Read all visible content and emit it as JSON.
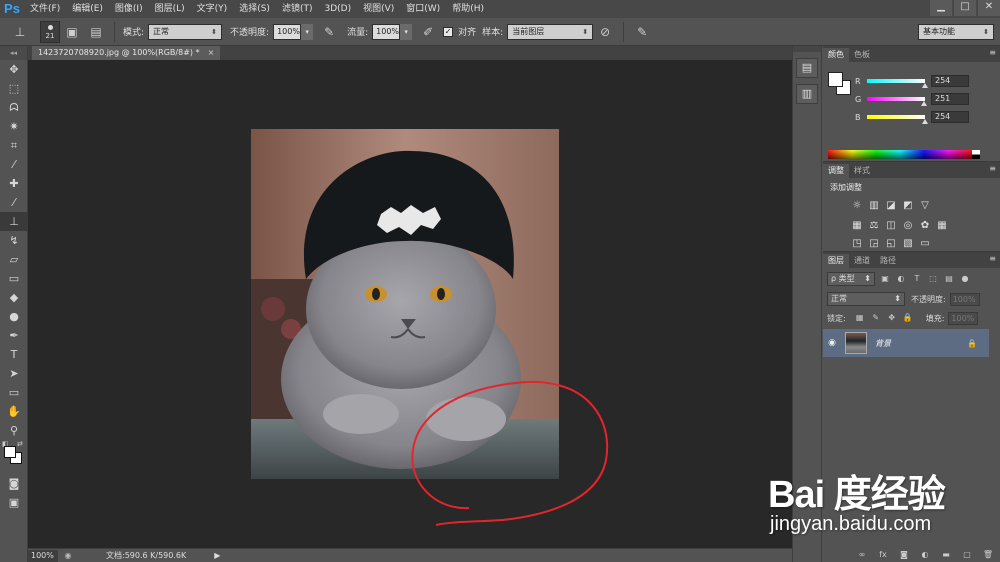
{
  "app": {
    "logo": "Ps"
  },
  "menu": [
    "文件(F)",
    "编辑(E)",
    "图像(I)",
    "图层(L)",
    "文字(Y)",
    "选择(S)",
    "滤镜(T)",
    "3D(D)",
    "视图(V)",
    "窗口(W)",
    "帮助(H)"
  ],
  "window_controls": {
    "minimize": "▁",
    "maximize": "□",
    "close": "✕"
  },
  "options": {
    "brush_size": "21",
    "mode_label": "模式:",
    "mode_value": "正常",
    "opacity_label": "不透明度:",
    "opacity_value": "100%",
    "flow_label": "流量:",
    "flow_value": "100%",
    "align_check": "✓",
    "align_label": "对齐",
    "sample_label": "样本:",
    "sample_value": "当前图层",
    "workspace": "基本功能"
  },
  "document": {
    "tab_title": "1423720708920.jpg @ 100%(RGB/8#) *",
    "tab_close": "×"
  },
  "status": {
    "zoom": "100%",
    "doc_info": "文档:590.6 K/590.6K",
    "arrow": "▶"
  },
  "color_panel": {
    "tabs": [
      "颜色",
      "色板"
    ],
    "channels": [
      {
        "label": "R",
        "value": "254",
        "fraction": 0.996
      },
      {
        "label": "G",
        "value": "251",
        "fraction": 0.984
      },
      {
        "label": "B",
        "value": "254",
        "fraction": 0.996
      }
    ]
  },
  "adjust_panel": {
    "tabs": [
      "调整",
      "样式"
    ],
    "title": "添加调整"
  },
  "layers_panel": {
    "tabs": [
      "图层",
      "通道",
      "路径"
    ],
    "filter_kind": "ρ 类型",
    "blend_mode": "正常",
    "opacity_label": "不透明度:",
    "opacity_value": "100%",
    "lock_label": "锁定:",
    "fill_label": "填充:",
    "fill_value": "100%",
    "layer_name": "背景"
  },
  "watermark": {
    "logo": "Bai 度经验",
    "url": "jingyan.baidu.com"
  },
  "colors": {
    "annotation": "#e3262b",
    "selected_layer": "#5d6c83"
  }
}
